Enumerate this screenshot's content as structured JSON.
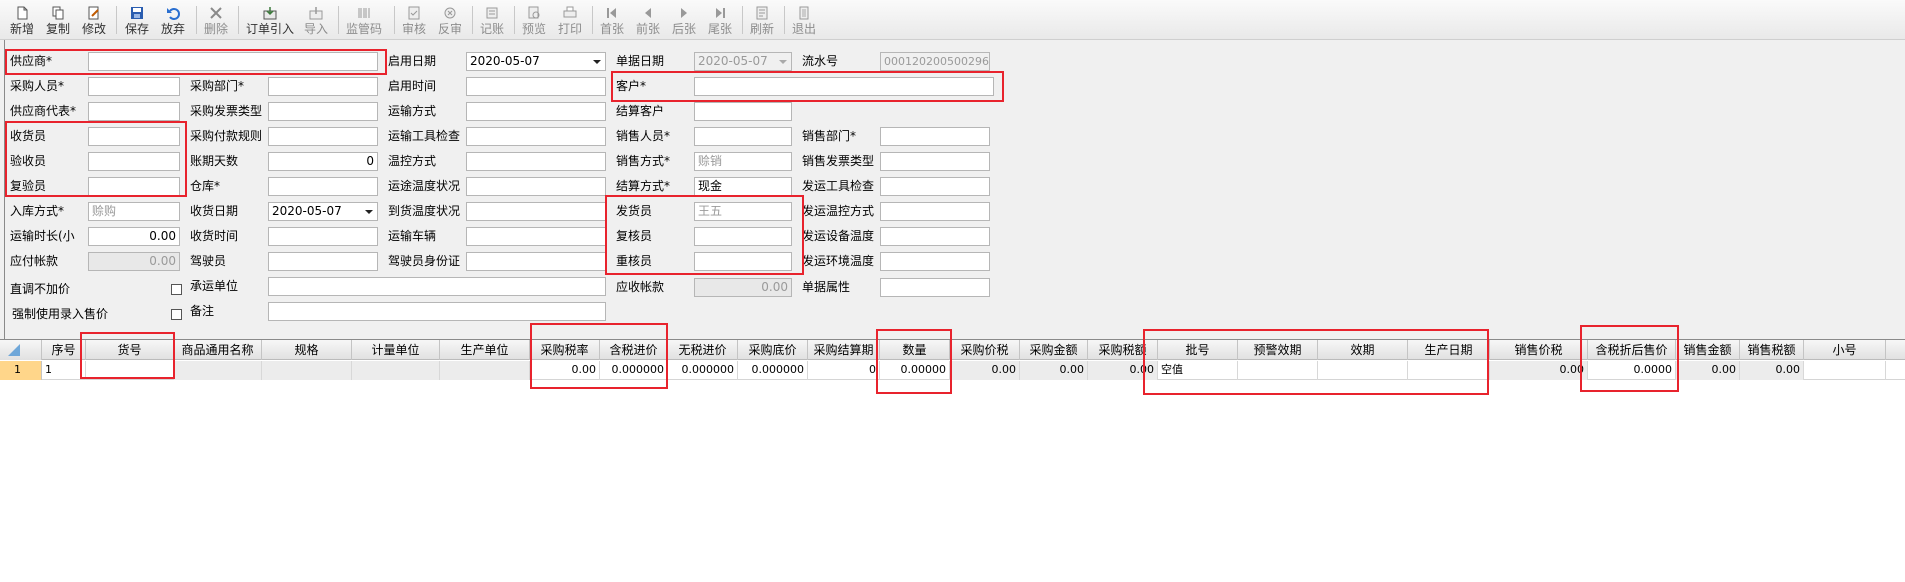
{
  "toolbar": {
    "buttons": [
      {
        "label": "新增",
        "icon": "new-doc-icon"
      },
      {
        "label": "复制",
        "icon": "copy-icon"
      },
      {
        "label": "修改",
        "icon": "edit-icon"
      },
      {
        "label": "保存",
        "icon": "save-icon"
      },
      {
        "label": "放弃",
        "icon": "undo-icon"
      },
      {
        "label": "删除",
        "icon": "delete-icon"
      },
      {
        "label": "订单引入",
        "icon": "import-order-icon"
      },
      {
        "label": "导入",
        "icon": "import-icon"
      },
      {
        "label": "监管码",
        "icon": "barcode-icon"
      },
      {
        "label": "审核",
        "icon": "audit-icon"
      },
      {
        "label": "反审",
        "icon": "unaudit-icon"
      },
      {
        "label": "记账",
        "icon": "post-icon"
      },
      {
        "label": "预览",
        "icon": "preview-icon"
      },
      {
        "label": "打印",
        "icon": "print-icon"
      },
      {
        "label": "首张",
        "icon": "first-icon"
      },
      {
        "label": "前张",
        "icon": "prev-icon"
      },
      {
        "label": "后张",
        "icon": "next-icon"
      },
      {
        "label": "尾张",
        "icon": "last-icon"
      },
      {
        "label": "刷新",
        "icon": "refresh-icon"
      },
      {
        "label": "退出",
        "icon": "exit-icon"
      }
    ]
  },
  "form": {
    "supplier_label": "供应商*",
    "supplier_value": "",
    "buyer_label": "采购人员*",
    "purchase_dept_label": "采购部门*",
    "supplier_rep_label": "供应商代表*",
    "purchase_invoice_type_label": "采购发票类型",
    "receiver_label": "收货员",
    "purchase_payment_rule_label": "采购付款规则",
    "inspector_label": "验收员",
    "payment_days_label": "账期天数",
    "payment_days_value": "0",
    "reviewer_label": "复验员",
    "warehouse_label": "仓库*",
    "stockin_method_label": "入库方式*",
    "stockin_method_value": "赊购",
    "receive_date_label": "收货日期",
    "receive_date_value": "2020-05-07",
    "transport_duration_label": "运输时长(小",
    "transport_duration_value": "0.00",
    "receive_time_label": "收货时间",
    "payable_label": "应付帐款",
    "payable_value": "0.00",
    "driver_label": "驾驶员",
    "no_price_add_label": "直调不加价",
    "carrier_label": "承运单位",
    "force_sale_price_label": "强制使用录入售价",
    "remark_label": "备注",
    "start_date_label": "启用日期",
    "start_date_value": "2020-05-07",
    "start_time_label": "启用时间",
    "transport_mode_label": "运输方式",
    "transport_tool_check_label": "运输工具检查",
    "temp_control_label": "温控方式",
    "transit_temp_label": "运途温度状况",
    "arrival_temp_label": "到货温度状况",
    "vehicle_label": "运输车辆",
    "driver_id_label": "驾驶员身份证",
    "doc_date_label": "单据日期",
    "doc_date_value": "2020-05-07",
    "serial_no_label": "流水号",
    "serial_no_value": "000120200500296",
    "customer_label": "客户*",
    "settle_customer_label": "结算客户",
    "salesperson_label": "销售人员*",
    "sales_dept_label": "销售部门*",
    "sales_method_label": "销售方式*",
    "sales_method_value": "赊销",
    "sales_invoice_type_label": "销售发票类型",
    "settle_method_label": "结算方式*",
    "settle_method_value": "现金",
    "ship_tool_check_label": "发运工具检查",
    "shipper_label": "发货员",
    "shipper_value": "王五",
    "ship_temp_control_label": "发运温控方式",
    "rechecker_label": "复核员",
    "ship_device_temp_label": "发运设备温度",
    "rechecker2_label": "重核员",
    "ship_env_temp_label": "发运环境温度",
    "receivable_label": "应收帐款",
    "receivable_value": "0.00",
    "doc_attr_label": "单据属性"
  },
  "grid": {
    "columns": [
      "序号",
      "货号",
      "商品通用名称",
      "规格",
      "计量单位",
      "生产单位",
      "采购税率",
      "含税进价",
      "无税进价",
      "采购底价",
      "采购结算期",
      "数量",
      "采购价税",
      "采购金额",
      "采购税额",
      "批号",
      "预警效期",
      "效期",
      "生产日期",
      "销售价税",
      "含税折后售价",
      "销售金额",
      "销售税额",
      "小号"
    ],
    "row": {
      "row_marker": "1",
      "seq": "1",
      "item_no": "",
      "name": "",
      "spec": "",
      "unit": "",
      "maker": "",
      "tax_rate": "0.00",
      "tax_price": "0.000000",
      "notax_price": "0.000000",
      "base_price": "0.000000",
      "settle_period": "0",
      "quantity": "0.00000",
      "purchase_total": "0.00",
      "purchase_amount": "0.00",
      "purchase_tax": "0.00",
      "batch_no": "空值",
      "warn_expiry": "",
      "expiry": "",
      "prod_date": "",
      "sale_total": "0.00",
      "discount_price": "0.0000",
      "sale_amount": "0.00",
      "sale_tax": "0.00",
      "small_no": ""
    }
  }
}
